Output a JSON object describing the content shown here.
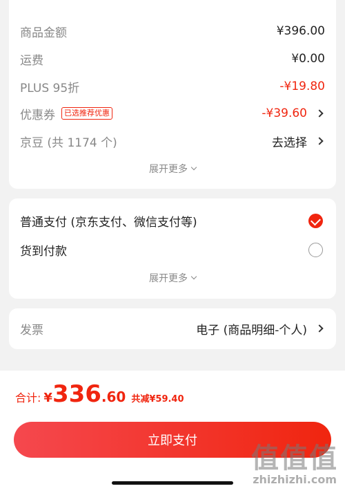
{
  "summary": {
    "rows": [
      {
        "label": "商品金额",
        "value": "¥396.00"
      },
      {
        "label": "运费",
        "value": "¥0.00"
      },
      {
        "label": "PLUS 95折",
        "value": "-¥19.80"
      },
      {
        "label": "优惠券",
        "badge": "已选推荐优惠",
        "value": "-¥39.60"
      },
      {
        "label": "京豆 (共 1174 个)",
        "value": "去选择"
      }
    ],
    "expand_label": "展开更多"
  },
  "payment": {
    "options": [
      {
        "label": "普通支付 (京东支付、微信支付等)",
        "selected": true
      },
      {
        "label": "货到付款",
        "selected": false
      }
    ],
    "expand_label": "展开更多"
  },
  "invoice": {
    "label": "发票",
    "value": "电子 (商品明细-个人)"
  },
  "footer": {
    "total_label": "合计:",
    "currency": "¥",
    "total_int": "336",
    "total_dec": ".60",
    "savings": "共减¥59.40",
    "pay_button": "立即支付"
  },
  "watermark": {
    "text": "值值值",
    "url": "zhizhizhi.com"
  },
  "colors": {
    "accent": "#f0250f",
    "background": "#f2f2f2"
  }
}
